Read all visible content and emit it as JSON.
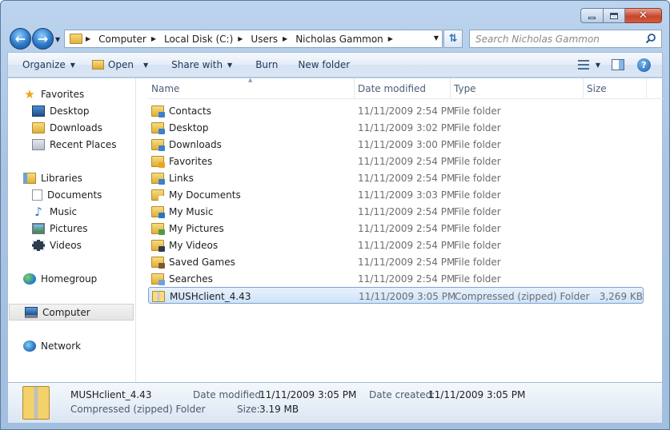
{
  "window": {
    "controls": {
      "minimize": "minimize-icon",
      "maximize": "maximize-icon",
      "close": "close-icon"
    }
  },
  "address": {
    "crumbs": [
      "Computer",
      "Local Disk (C:)",
      "Users",
      "Nicholas Gammon"
    ]
  },
  "search": {
    "placeholder": "Search Nicholas Gammon"
  },
  "toolbar": {
    "organize": "Organize",
    "open": "Open",
    "share_with": "Share with",
    "burn": "Burn",
    "new_folder": "New folder"
  },
  "nav": {
    "favorites": {
      "label": "Favorites",
      "items": [
        "Desktop",
        "Downloads",
        "Recent Places"
      ]
    },
    "libraries": {
      "label": "Libraries",
      "items": [
        "Documents",
        "Music",
        "Pictures",
        "Videos"
      ]
    },
    "homegroup": "Homegroup",
    "computer": "Computer",
    "network": "Network"
  },
  "columns": {
    "name": "Name",
    "date": "Date modified",
    "type": "Type",
    "size": "Size"
  },
  "files": [
    {
      "name": "Contacts",
      "date": "11/11/2009 2:54 PM",
      "type": "File folder",
      "size": ""
    },
    {
      "name": "Desktop",
      "date": "11/11/2009 3:02 PM",
      "type": "File folder",
      "size": ""
    },
    {
      "name": "Downloads",
      "date": "11/11/2009 3:00 PM",
      "type": "File folder",
      "size": ""
    },
    {
      "name": "Favorites",
      "date": "11/11/2009 2:54 PM",
      "type": "File folder",
      "size": ""
    },
    {
      "name": "Links",
      "date": "11/11/2009 2:54 PM",
      "type": "File folder",
      "size": ""
    },
    {
      "name": "My Documents",
      "date": "11/11/2009 3:03 PM",
      "type": "File folder",
      "size": ""
    },
    {
      "name": "My Music",
      "date": "11/11/2009 2:54 PM",
      "type": "File folder",
      "size": ""
    },
    {
      "name": "My Pictures",
      "date": "11/11/2009 2:54 PM",
      "type": "File folder",
      "size": ""
    },
    {
      "name": "My Videos",
      "date": "11/11/2009 2:54 PM",
      "type": "File folder",
      "size": ""
    },
    {
      "name": "Saved Games",
      "date": "11/11/2009 2:54 PM",
      "type": "File folder",
      "size": ""
    },
    {
      "name": "Searches",
      "date": "11/11/2009 2:54 PM",
      "type": "File folder",
      "size": ""
    },
    {
      "name": "MUSHclient_4.43",
      "date": "11/11/2009 3:05 PM",
      "type": "Compressed (zipped) Folder",
      "size": "3,269 KB"
    }
  ],
  "details": {
    "name": "MUSHclient_4.43",
    "type": "Compressed (zipped) Folder",
    "date_modified_label": "Date modified:",
    "date_modified": "11/11/2009 3:05 PM",
    "date_created_label": "Date created:",
    "date_created": "11/11/2009 3:05 PM",
    "size_label": "Size:",
    "size": "3.19 MB"
  }
}
